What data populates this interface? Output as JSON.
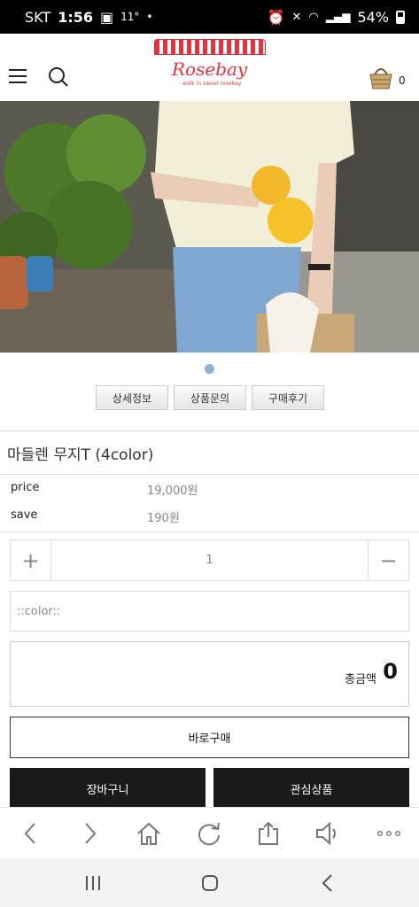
{
  "status_bar": {
    "carrier": "SKT",
    "time": "1:56",
    "temperature": "11°",
    "battery": "54%"
  },
  "header": {
    "logo_text": "Rosebay",
    "logo_tagline": "walk in sweet rosebay",
    "cart_count": "0",
    "brand_color": "#e0343f"
  },
  "tabs": [
    "상세정보",
    "상품문의",
    "구매후기"
  ],
  "product": {
    "title": "마들렌 무지T (4color)",
    "price_label": "price",
    "price_value": "19,000원",
    "save_label": "save",
    "save_value": "190원"
  },
  "quantity": {
    "plus": "+",
    "value": "1",
    "minus": "−"
  },
  "color_select": {
    "selected": "::color::"
  },
  "total": {
    "label": "총금액",
    "value": "0"
  },
  "buttons": {
    "buy_now": "바로구매",
    "cart": "장바구니",
    "wishlist": "관심상품"
  },
  "browser_toolbar": {
    "icons": [
      "back-icon",
      "forward-icon",
      "home-icon",
      "refresh-icon",
      "share-icon",
      "speaker-icon",
      "more-icon"
    ]
  },
  "system_nav": {
    "icons": [
      "recent-apps-icon",
      "home-button-icon",
      "back-nav-icon"
    ]
  }
}
